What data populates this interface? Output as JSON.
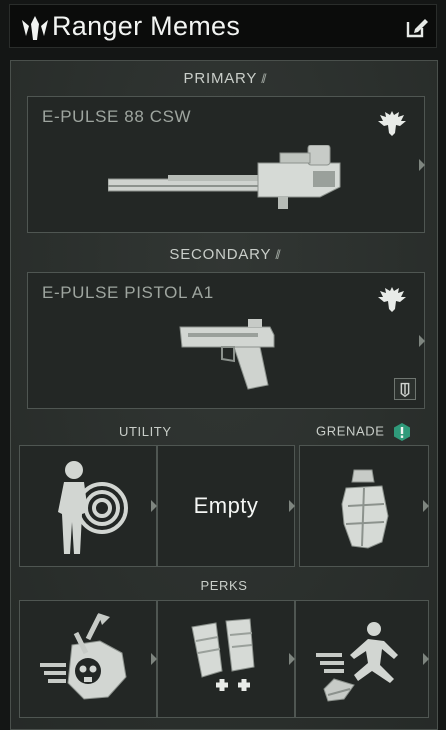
{
  "header": {
    "title": "Ranger Memes",
    "logo_icon": "helldivers-logo-icon",
    "edit_icon": "edit-icon"
  },
  "primary": {
    "label": "PRIMARY",
    "slashes": "//",
    "weapon_name": "E-PULSE 88 CSW"
  },
  "secondary": {
    "label": "SECONDARY",
    "slashes": "//",
    "weapon_name": "E-PULSE PISTOL A1"
  },
  "utility": {
    "label": "UTILITY",
    "slot2_text": "Empty"
  },
  "grenade": {
    "label": "GRENADE"
  },
  "perks": {
    "label": "PERKS"
  },
  "colors": {
    "accent_badge": "#2f9a7a",
    "panel_bg": "#2b302d",
    "card_border": "#4f5652"
  }
}
